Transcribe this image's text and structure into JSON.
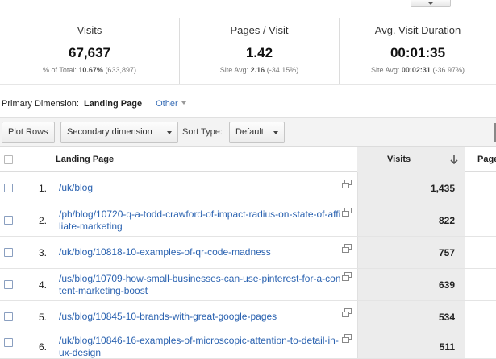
{
  "summary": [
    {
      "label": "Visits",
      "value": "67,637",
      "sub_prefix": "% of Total:",
      "sub_bold": "10.67%",
      "sub_suffix": "(633,897)"
    },
    {
      "label": "Pages / Visit",
      "value": "1.42",
      "sub_prefix": "Site Avg:",
      "sub_bold": "2.16",
      "sub_suffix": "(-34.15%)"
    },
    {
      "label": "Avg. Visit Duration",
      "value": "00:01:35",
      "sub_prefix": "Site Avg:",
      "sub_bold": "00:02:31",
      "sub_suffix": "(-36.97%)"
    }
  ],
  "primary_dimension": {
    "label": "Primary Dimension:",
    "value": "Landing Page",
    "other_label": "Other"
  },
  "toolbar": {
    "plot_rows_label": "Plot Rows",
    "secondary_dimension_label": "Secondary dimension",
    "sort_type_label": "Sort Type:",
    "sort_type_value": "Default"
  },
  "table": {
    "headers": {
      "landing_page": "Landing Page",
      "visits": "Visits",
      "pages": "Page"
    },
    "rows": [
      {
        "num": "1.",
        "page": "/uk/blog",
        "visits": "1,435"
      },
      {
        "num": "2.",
        "page": "/ph/blog/10720-q-a-todd-crawford-of-impact-radius-on-state-of-affiliate-marketing",
        "visits": "822"
      },
      {
        "num": "3.",
        "page": "/uk/blog/10818-10-examples-of-qr-code-madness",
        "visits": "757"
      },
      {
        "num": "4.",
        "page": "/us/blog/10709-how-small-businesses-can-use-pinterest-for-a-content-marketing-boost",
        "visits": "639"
      },
      {
        "num": "5.",
        "page": "/us/blog/10845-10-brands-with-great-google-pages",
        "visits": "534"
      },
      {
        "num": "6.",
        "page": "/uk/blog/10846-16-examples-of-microscopic-attention-to-detail-in-ux-design",
        "visits": "511"
      }
    ]
  },
  "colors": {
    "link": "#2a62b0",
    "visits_column_bg": "#ececec",
    "toolbar_bg": "#f3f3f3"
  },
  "icons": {
    "row_action": "open-in-new-window-icon",
    "sort": "sort-descending-arrow-icon",
    "caret": "chevron-down-icon"
  }
}
